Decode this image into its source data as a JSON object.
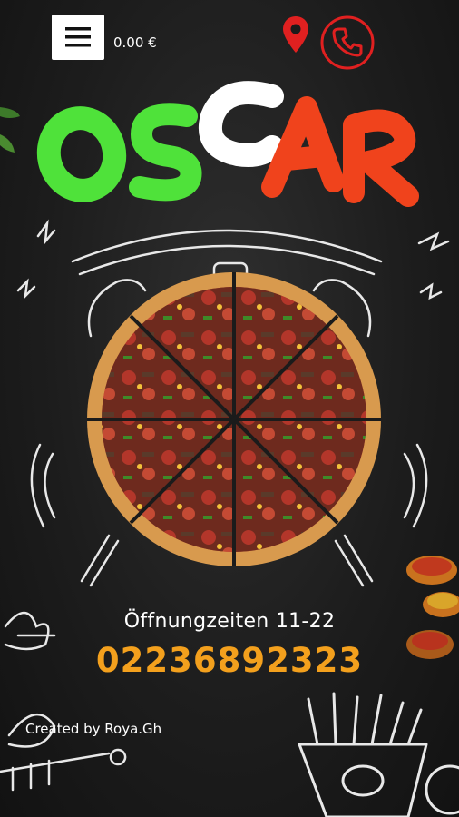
{
  "header": {
    "price": "0.00 €",
    "menu_icon": "hamburger-menu-icon",
    "location_icon": "map-pin-icon",
    "call_icon": "phone-icon"
  },
  "logo": {
    "letters": [
      "O",
      "S",
      "C",
      "A",
      "R"
    ],
    "colors": {
      "green": "#4fe23a",
      "white": "#ffffff",
      "red": "#f0431c"
    }
  },
  "info": {
    "hours": "Öffnungzeiten 11-22",
    "phone": "02236892323",
    "phone_color": "#f3a01d"
  },
  "footer": {
    "credit": "Created by Roya.Gh"
  },
  "accent": {
    "pin": "#e02020",
    "call": "#e02020"
  }
}
